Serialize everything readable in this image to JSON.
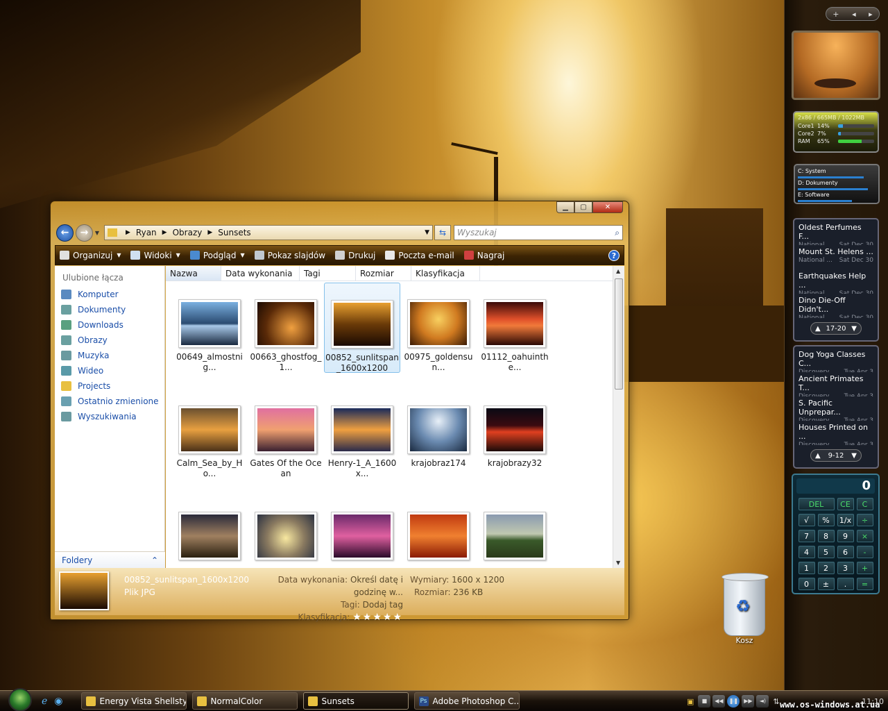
{
  "explorer": {
    "breadcrumb": [
      "Ryan",
      "Obrazy",
      "Sunsets"
    ],
    "search_placeholder": "Wyszukaj",
    "toolbar": [
      {
        "label": "Organizuj",
        "dropdown": true,
        "icon": "organize-icon",
        "color": "#e0e0e0"
      },
      {
        "label": "Widoki",
        "dropdown": true,
        "icon": "views-icon",
        "color": "#d0e0f0"
      },
      {
        "label": "Podgląd",
        "dropdown": true,
        "icon": "preview-icon",
        "color": "#4a8ad0"
      },
      {
        "label": "Pokaz slajdów",
        "dropdown": false,
        "icon": "slideshow-icon",
        "color": "#c0c8d0"
      },
      {
        "label": "Drukuj",
        "dropdown": false,
        "icon": "print-icon",
        "color": "#d0d0d0"
      },
      {
        "label": "Poczta e-mail",
        "dropdown": false,
        "icon": "email-icon",
        "color": "#e8e8e8"
      },
      {
        "label": "Nagraj",
        "dropdown": false,
        "icon": "burn-icon",
        "color": "#d04040"
      }
    ],
    "nav": {
      "header": "Ulubione łącza",
      "items": [
        {
          "label": "Komputer",
          "icon": "computer-icon",
          "color": "#5a8ac0"
        },
        {
          "label": "Dokumenty",
          "icon": "documents-icon",
          "color": "#6aa0a0"
        },
        {
          "label": "Downloads",
          "icon": "downloads-icon",
          "color": "#5aa080"
        },
        {
          "label": "Obrazy",
          "icon": "pictures-icon",
          "color": "#6aa0a0"
        },
        {
          "label": "Muzyka",
          "icon": "music-icon",
          "color": "#6a9aa0"
        },
        {
          "label": "Wideo",
          "icon": "video-icon",
          "color": "#5a9aa8"
        },
        {
          "label": "Projects",
          "icon": "projects-icon",
          "color": "#e8c040"
        },
        {
          "label": "Ostatnio zmienione",
          "icon": "recent-icon",
          "color": "#6aa0b0"
        },
        {
          "label": "Wyszukiwania",
          "icon": "searches-icon",
          "color": "#6a9aa0"
        }
      ],
      "folders_label": "Foldery"
    },
    "columns": [
      "Nazwa",
      "Data wykonania",
      "Tagi",
      "Rozmiar",
      "Klasyfikacja"
    ],
    "files": [
      {
        "name": "00649_almostnig...",
        "thumb": "linear-gradient(#7ab0e0, #2a4a70 50%, #a8c8e8 55%, #1a2a40)"
      },
      {
        "name": "00663_ghostfog_1...",
        "thumb": "radial-gradient(circle at 60% 60%, #f0a040, #5a2a08 60%, #1a0a02)"
      },
      {
        "name": "00852_sunlitspan_1600x1200",
        "thumb": "linear-gradient(#e8a030, #6a3a08 50%, #1a0a02)",
        "selected": true
      },
      {
        "name": "00975_goldensun...",
        "thumb": "radial-gradient(circle at 50% 40%, #f8d060, #d07a20 50%, #3a1a04)"
      },
      {
        "name": "01112_oahuinthe...",
        "thumb": "linear-gradient(#3a0a08, #e0502a 40%, #f07a3a 55%, #2a0804)"
      },
      {
        "name": "Calm_Sea_by_Ho...",
        "thumb": "linear-gradient(#6a5030, #e8a040 50%, #4a3018)"
      },
      {
        "name": "Gates Of the Ocean",
        "thumb": "linear-gradient(#e070a0, #f0a070 50%, #3a2030)"
      },
      {
        "name": "Henry-1_A_1600x...",
        "thumb": "linear-gradient(#1a2a5a, #f0a040 50%, #2a2a4a)"
      },
      {
        "name": "krajobraz174",
        "thumb": "radial-gradient(circle at 50% 30%, #e8f0f8, #6a8ab0 50%, #1a2a40)"
      },
      {
        "name": "krajobrazy32",
        "thumb": "linear-gradient(#0a0a14, #3a0a10 40%, #e04020 55%, #1a0a08)"
      },
      {
        "name": "",
        "thumb": "linear-gradient(#2a2a3a, #a08060 50%, #2a2010)"
      },
      {
        "name": "",
        "thumb": "radial-gradient(circle at 50% 55%, #f8e8a0, #8a7a60 50%, #2a3040)"
      },
      {
        "name": "",
        "thumb": "linear-gradient(#6a2a6a, #e060a0 50%, #2a0a2a)"
      },
      {
        "name": "",
        "thumb": "linear-gradient(#c03a10, #f08030 50%, #8a1a04)"
      },
      {
        "name": "",
        "thumb": "linear-gradient(#8a9ab0, #c0c8b0 45%, #3a5a2a 60%, #2a3a1a)"
      }
    ],
    "details": {
      "name": "00852_sunlitspan_1600x1200",
      "type": "Plik JPG",
      "date_label": "Data wykonania:",
      "date_value": "Określ datę i godzinę w...",
      "tags_label": "Tagi:",
      "tags_value": "Dodaj tag",
      "rating_label": "Klasyfikacja:",
      "rating": "★★★★★",
      "dim_label": "Wymiary:",
      "dim_value": "1600 x 1200",
      "size_label": "Rozmiar:",
      "size_value": "236 KB"
    }
  },
  "sidebar": {
    "cpu": {
      "header": "2x86 / 665MB / 1022MB",
      "rows": [
        {
          "label": "Core1",
          "value": "14%",
          "level": 0.14
        },
        {
          "label": "Core2",
          "value": "7%",
          "level": 0.07
        },
        {
          "label": "RAM",
          "value": "65%",
          "level": 0.65
        }
      ]
    },
    "drives": [
      {
        "label": "C: System",
        "level": 0.85
      },
      {
        "label": "D: Dokumenty",
        "level": 0.9
      },
      {
        "label": "E: Software",
        "level": 0.7
      }
    ],
    "news1": {
      "items": [
        {
          "title": "Oldest Perfumes F...",
          "source": "National ...",
          "date": "Sat Dec 30"
        },
        {
          "title": "Mount St. Helens ...",
          "source": "National ...",
          "date": "Sat Dec 30"
        },
        {
          "title": "Earthquakes Help ...",
          "source": "National ...",
          "date": "Sat Dec 30"
        },
        {
          "title": "Dino Die-Off Didn't...",
          "source": "National ...",
          "date": "Sat Dec 30"
        }
      ],
      "page": "17-20"
    },
    "news2": {
      "items": [
        {
          "title": "Dog Yoga Classes C...",
          "source": "Discovery...",
          "date": "Tue Apr 3"
        },
        {
          "title": "Ancient Primates T...",
          "source": "Discovery...",
          "date": "Tue Apr 3"
        },
        {
          "title": "S. Pacific Unprepar...",
          "source": "Discovery...",
          "date": "Tue Apr 3"
        },
        {
          "title": "Houses Printed on ...",
          "source": "Discovery...",
          "date": "Tue Apr 3"
        }
      ],
      "page": "9-12"
    },
    "calc": {
      "display": "0",
      "keys": [
        "DEL",
        "CE",
        "C",
        "√",
        "%",
        "1/x",
        "÷",
        "7",
        "8",
        "9",
        "×",
        "4",
        "5",
        "6",
        "-",
        "1",
        "2",
        "3",
        "+",
        "0",
        "±",
        ".",
        "="
      ]
    }
  },
  "desktop": {
    "recycle_label": "Kosz"
  },
  "taskbar": {
    "buttons": [
      {
        "label": "Energy Vista Shellsty...",
        "icon": "folder-icon"
      },
      {
        "label": "NormalColor",
        "icon": "folder-icon"
      },
      {
        "label": "Sunsets",
        "icon": "folder-icon",
        "active": true
      },
      {
        "label": "Adobe Photoshop C...",
        "icon": "photoshop-icon"
      }
    ],
    "clock": "11:10"
  },
  "watermark": "www.os-windows.at.ua"
}
